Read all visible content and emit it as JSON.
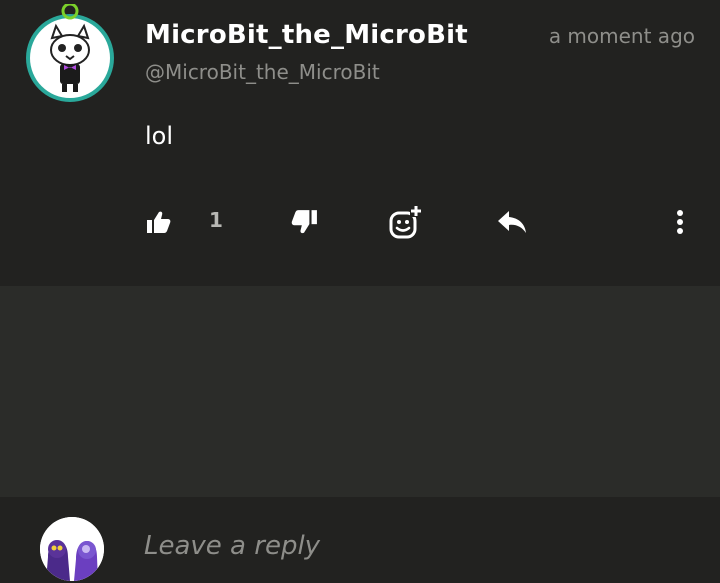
{
  "comment": {
    "username": "MicroBit_the_MicroBit",
    "handle": "@MicroBit_the_MicroBit",
    "timestamp": "a moment ago",
    "body": "lol",
    "like_count": "1"
  },
  "icons": {
    "like": "thumbs-up-icon",
    "dislike": "thumbs-down-icon",
    "react": "add-reaction-icon",
    "reply": "reply-arrow-icon",
    "more": "more-vertical-icon"
  },
  "reply_bar": {
    "placeholder": "Leave a reply"
  },
  "colors": {
    "comment_bg": "#222220",
    "page_bg": "#2b2c29",
    "text_primary": "#ffffff",
    "text_secondary": "#8e8e8a",
    "avatar_ring": "#2aa89a"
  }
}
